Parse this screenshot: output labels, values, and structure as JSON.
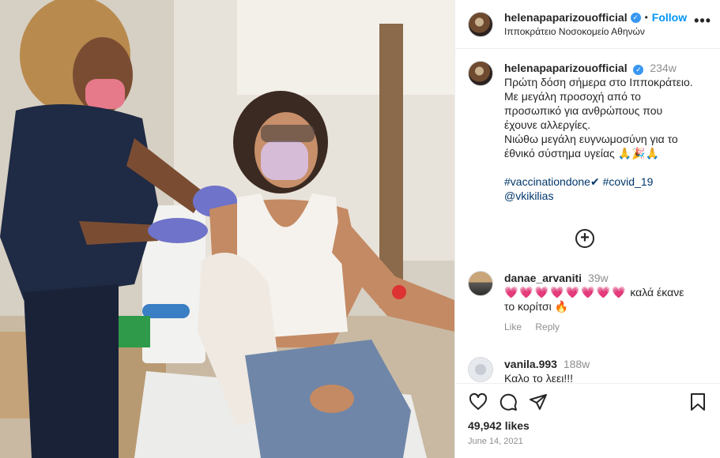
{
  "post": {
    "username": "helenapaparizouofficial",
    "verified_icon": "verified-badge-icon",
    "separator": "•",
    "follow_label": "Follow",
    "location": "Ιπποκράτειο Νοσοκομείο Αθηνών",
    "more_label": "•••"
  },
  "caption": {
    "username": "helenapaparizouofficial",
    "time": "234w",
    "lines": [
      "Πρώτη δόση σήμερα στο Ιπποκράτειο.",
      "Με μεγάλη προσοχή από το",
      "προσωπικό για ανθρώπους που",
      "έχουνε αλλεργίες.",
      "Νιώθω μεγάλη ευγνωμοσύνη για το",
      "έθνικό σύστημα υγείας 🙏🎉🙏"
    ],
    "hashtag1": "#vaccinationdone",
    "hashtag2": "#covid_19",
    "mention": "@vkikilias",
    "check": "✔"
  },
  "load_more_label": "+",
  "comments": [
    {
      "username": "danae_arvaniti",
      "time": "39w",
      "hearts": "💗💗💗💗💗💗💗💗",
      "text": "καλά έκανε",
      "text2": "το κορίτσι 🔥",
      "like_label": "Like",
      "reply_label": "Reply"
    },
    {
      "username": "vanila.993",
      "time": "188w",
      "text": "Καλο το λεει!!!"
    }
  ],
  "footer": {
    "likes": "49,942 likes",
    "date": "June 14, 2021"
  },
  "icons": {
    "like": "heart-icon",
    "comment": "comment-icon",
    "share": "share-icon",
    "save": "bookmark-icon"
  },
  "colors": {
    "link": "#00376b",
    "follow": "#0095f6",
    "verified": "#3897f0"
  }
}
